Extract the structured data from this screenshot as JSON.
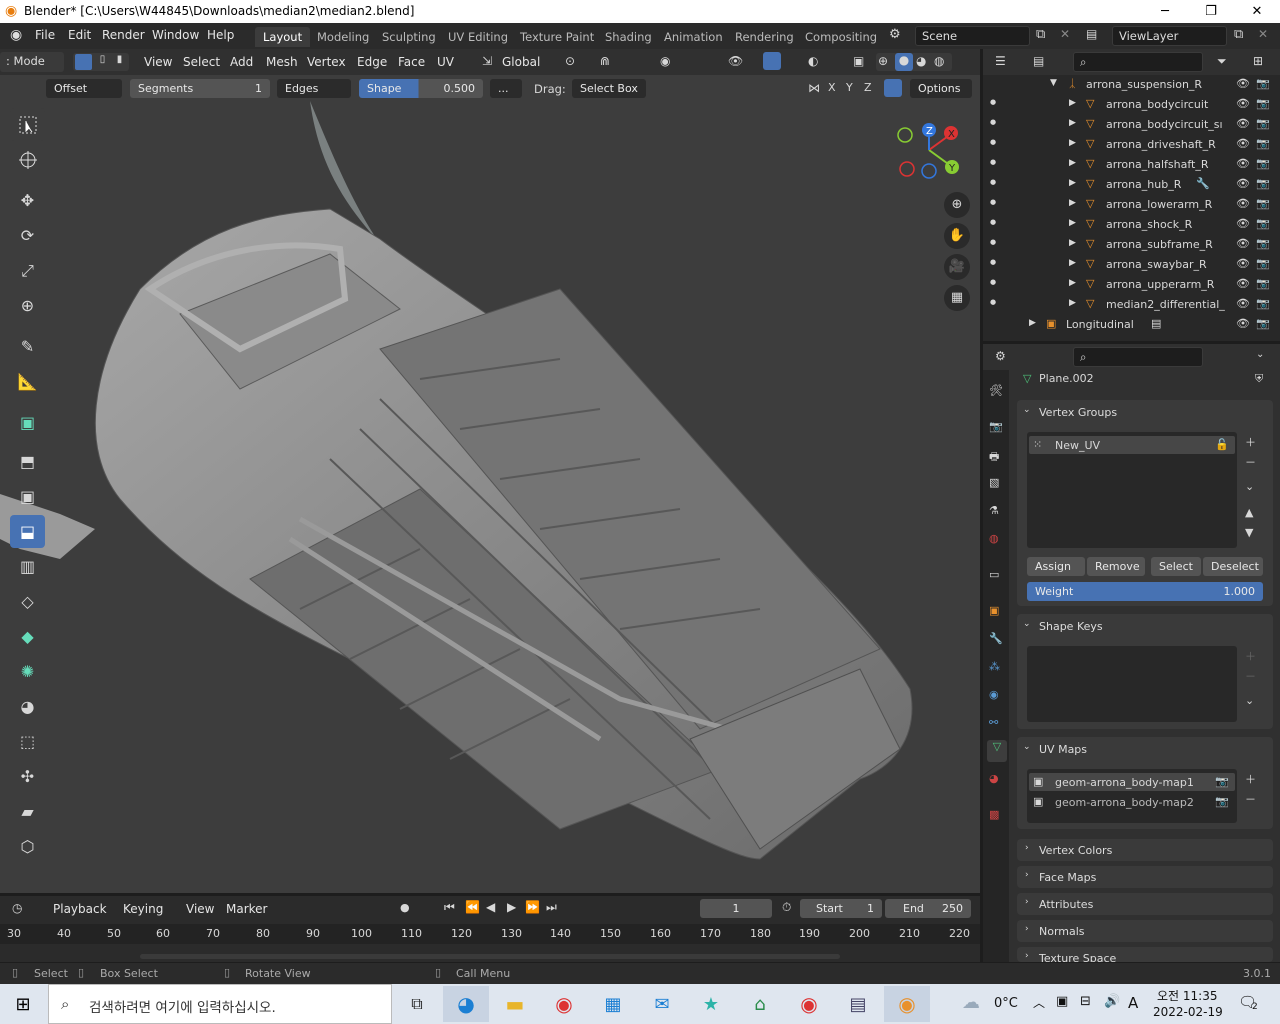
{
  "window": {
    "title": "Blender* [C:\\Users\\W44845\\Downloads\\median2\\median2.blend]"
  },
  "menu": [
    "File",
    "Edit",
    "Render",
    "Window",
    "Help"
  ],
  "workspaces": [
    "Layout",
    "Modeling",
    "Sculpting",
    "UV Editing",
    "Texture Paint",
    "Shading",
    "Animation",
    "Rendering",
    "Compositing"
  ],
  "scene": "Scene",
  "viewlayer": "ViewLayer",
  "viewport_header": {
    "mode": ": Mode",
    "items": [
      "View",
      "Select",
      "Add",
      "Mesh",
      "Vertex",
      "Edge",
      "Face",
      "UV"
    ],
    "orientation": "Global"
  },
  "tool_options": {
    "offset": "Offset",
    "segments_label": "Segments",
    "segments_value": "1",
    "edges": "Edges",
    "shape_label": "Shape",
    "shape_value": "0.500",
    "more": "...",
    "drag_label": "Drag:",
    "drag_value": "Select Box",
    "options": "Options",
    "axes": [
      "X",
      "Y",
      "Z"
    ]
  },
  "gizmo": {
    "x": "X",
    "y": "Y",
    "z": "Z"
  },
  "outliner": {
    "items": [
      {
        "name": "arrona_suspension_R",
        "indent": 1
      },
      {
        "name": "arrona_bodycircuit",
        "indent": 2
      },
      {
        "name": "arrona_bodycircuit_sı",
        "indent": 2
      },
      {
        "name": "arrona_driveshaft_R",
        "indent": 2
      },
      {
        "name": "arrona_halfshaft_R",
        "indent": 2
      },
      {
        "name": "arrona_hub_R",
        "indent": 2
      },
      {
        "name": "arrona_lowerarm_R",
        "indent": 2
      },
      {
        "name": "arrona_shock_R",
        "indent": 2
      },
      {
        "name": "arrona_subframe_R",
        "indent": 2
      },
      {
        "name": "arrona_swaybar_R",
        "indent": 2
      },
      {
        "name": "arrona_upperarm_R",
        "indent": 2
      },
      {
        "name": "median2_differential_",
        "indent": 2
      },
      {
        "name": "Longitudinal",
        "indent": 0
      }
    ]
  },
  "properties": {
    "object_name": "Plane.002",
    "vertex_groups": {
      "title": "Vertex Groups",
      "items": [
        "New_UV"
      ],
      "assign": "Assign",
      "remove": "Remove",
      "select": "Select",
      "deselect": "Deselect",
      "weight_label": "Weight",
      "weight_value": "1.000"
    },
    "shape_keys": {
      "title": "Shape Keys"
    },
    "uv_maps": {
      "title": "UV Maps",
      "items": [
        "geom-arrona_body-map1",
        "geom-arrona_body-map2"
      ]
    },
    "collapsed": [
      "Vertex Colors",
      "Face Maps",
      "Attributes",
      "Normals",
      "Texture Space"
    ]
  },
  "timeline": {
    "playback": "Playback",
    "keying": "Keying",
    "view": "View",
    "marker": "Marker",
    "current_frame": "1",
    "start_label": "Start",
    "start": "1",
    "end_label": "End",
    "end": "250",
    "ticks": [
      "30",
      "40",
      "50",
      "60",
      "70",
      "80",
      "90",
      "100",
      "110",
      "120",
      "130",
      "140",
      "150",
      "160",
      "170",
      "180",
      "190",
      "200",
      "210",
      "220"
    ]
  },
  "statusbar": {
    "select": "Select",
    "box_select": "Box Select",
    "rotate": "Rotate View",
    "call_menu": "Call Menu",
    "version": "3.0.1"
  },
  "taskbar": {
    "search_placeholder": "검색하려면 여기에 입력하십시오.",
    "weather": "0°C",
    "ime": "A",
    "time": "오전 11:35",
    "date": "2022-02-19",
    "notifications": "2"
  }
}
